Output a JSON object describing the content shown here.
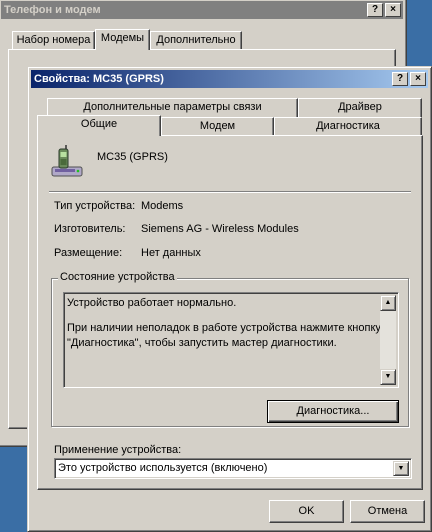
{
  "back_window": {
    "title": "Телефон и модем",
    "help_btn": "?",
    "close_btn": "×",
    "tabs": [
      "Набор номера",
      "Модемы",
      "Дополнительно"
    ]
  },
  "dialog": {
    "title": "Свойства: MC35 (GPRS)",
    "help_btn": "?",
    "close_btn": "×",
    "tabs_row1": [
      "Дополнительные параметры связи",
      "Драйвер"
    ],
    "tabs_row2": [
      "Общие",
      "Модем",
      "Диагностика"
    ],
    "selected_tab": "Общие",
    "device_name": "MC35 (GPRS)",
    "device_icon": "phone-modem-icon",
    "props": [
      {
        "label": "Тип устройства:",
        "value": "Modems"
      },
      {
        "label": "Изготовитель:",
        "value": "Siemens AG - Wireless Modules"
      },
      {
        "label": "Размещение:",
        "value": "Нет данных"
      }
    ],
    "status_group_label": "Состояние устройства",
    "status_line1": "Устройство работает нормально.",
    "status_line2": "При наличии неполадок в работе устройства нажмите кнопку",
    "status_line3": "\"Диагностика\", чтобы запустить мастер диагностики.",
    "diagnostics_button": "Диагностика...",
    "usage_label": "Применение устройства:",
    "usage_value": "Это устройство используется (включено)",
    "ok_button": "OK",
    "cancel_button": "Отмена"
  },
  "colors": {
    "desktop": "#3a6ea5",
    "face": "#d4d0c8",
    "title_active_start": "#0a246a",
    "title_active_end": "#a6caf0",
    "title_inactive": "#808080"
  }
}
